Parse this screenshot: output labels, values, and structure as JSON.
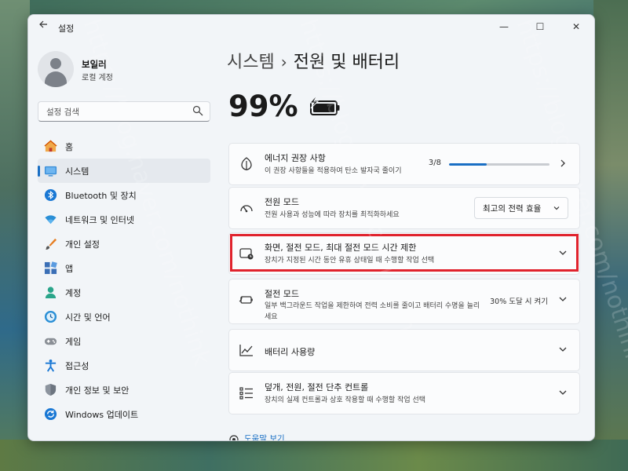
{
  "window": {
    "app_title": "설정",
    "controls": {
      "minimize": "—",
      "maximize": "☐",
      "close": "✕"
    }
  },
  "user": {
    "name": "보일러",
    "account_type": "로컬 계정"
  },
  "search": {
    "placeholder": "설정 검색"
  },
  "sidebar": {
    "items": [
      {
        "label": "홈",
        "icon": "home-icon"
      },
      {
        "label": "시스템",
        "icon": "system-icon",
        "active": true
      },
      {
        "label": "Bluetooth 및 장치",
        "icon": "bluetooth-icon"
      },
      {
        "label": "네트워크 및 인터넷",
        "icon": "network-icon"
      },
      {
        "label": "개인 설정",
        "icon": "brush-icon"
      },
      {
        "label": "앱",
        "icon": "apps-icon"
      },
      {
        "label": "계정",
        "icon": "account-icon"
      },
      {
        "label": "시간 및 언어",
        "icon": "time-language-icon"
      },
      {
        "label": "게임",
        "icon": "gaming-icon"
      },
      {
        "label": "접근성",
        "icon": "accessibility-icon"
      },
      {
        "label": "개인 정보 및 보안",
        "icon": "shield-icon"
      },
      {
        "label": "Windows 업데이트",
        "icon": "update-icon"
      }
    ]
  },
  "breadcrumb": {
    "parent": "시스템",
    "separator": "›",
    "current": "전원 및 배터리"
  },
  "battery": {
    "percent": "99%",
    "charging": true
  },
  "cards": {
    "energy": {
      "title": "에너지 권장 사항",
      "subtitle": "이 권장 사항들을 적용하여 탄소 발자국 줄이기",
      "progress_text": "3/8",
      "progress_fraction": 0.375
    },
    "power_mode": {
      "title": "전원 모드",
      "subtitle": "전원 사용과 성능에 따라 장치를 최적화하세요",
      "value": "최고의 전력 효율"
    },
    "screen_sleep": {
      "title": "화면, 절전 모드, 최대 절전 모드 시간 제한",
      "subtitle": "장치가 지정된 시간 동안 유휴 상태일 때 수행할 작업 선택"
    },
    "battery_saver": {
      "title": "절전 모드",
      "subtitle": "일부 백그라운드 작업을 제한하여 전력 소비를 줄이고 배터리 수명을 늘리세요",
      "status": "30% 도달 시 켜기"
    },
    "battery_usage": {
      "title": "배터리 사용량"
    },
    "lid_controls": {
      "title": "덮개, 전원, 절전 단추 컨트롤",
      "subtitle": "장치의 실제 컨트롤과 상호 작용할 때 수행할 작업 선택"
    }
  },
  "help": {
    "label": "도움말 보기"
  },
  "watermark": {
    "text": "https://blog.naver.com/nothink"
  },
  "colors": {
    "accent": "#1a6fc4",
    "highlight": "#e0232d",
    "window_bg": "#f2f5f8"
  }
}
